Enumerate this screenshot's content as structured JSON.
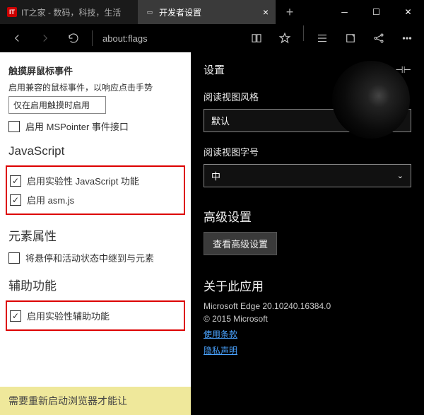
{
  "tabs": {
    "inactive": {
      "label": "IT之家 - 数码，科技，生活"
    },
    "active": {
      "label": "开发者设置"
    }
  },
  "url": "about:flags",
  "left": {
    "section_touch": "触摸屏鼠标事件",
    "touch_desc": "启用兼容的鼠标事件，以响应点击手势",
    "touch_dropdown": "仅在启用触摸时启用",
    "mspointer_label": "启用 MSPointer 事件接口",
    "js_heading": "JavaScript",
    "js_exp_label": "启用实验性 JavaScript 功能",
    "asm_label": "启用 asm.js",
    "elem_heading": "元素属性",
    "elem_cb": "将悬停和活动状态中继到与元素",
    "assist_heading": "辅助功能",
    "assist_cb_label": "启用实验性辅助功能",
    "restart_banner": "需要重新启动浏览器才能让"
  },
  "right": {
    "panel_title": "设置",
    "read_style_label": "阅读视图风格",
    "read_style_value": "默认",
    "read_size_label": "阅读视图字号",
    "read_size_value": "中",
    "advanced_heading": "高级设置",
    "advanced_btn": "查看高级设置",
    "about_heading": "关于此应用",
    "version": "Microsoft Edge 20.10240.16384.0",
    "copyright": "© 2015 Microsoft",
    "terms_link": "使用条款",
    "privacy_link": "隐私声明"
  }
}
